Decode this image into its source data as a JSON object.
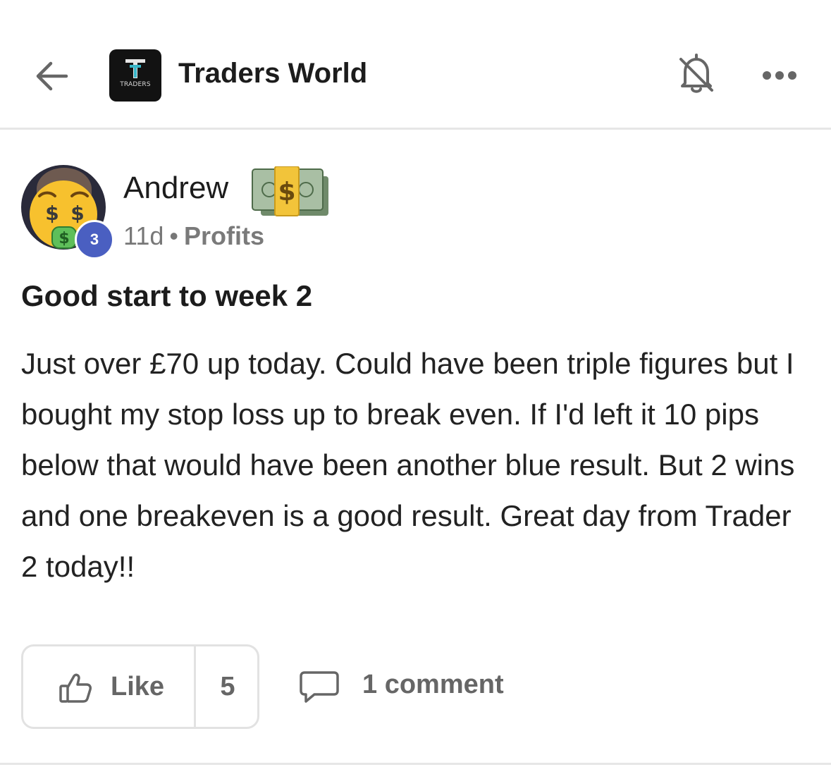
{
  "header": {
    "back_icon": "arrow-left-icon",
    "group_logo_text": "TRADERS",
    "group_title": "Traders World",
    "notifications_icon": "bell-off-icon",
    "more_icon": "more-horizontal-icon"
  },
  "post": {
    "author": {
      "name": "Andrew",
      "name_emoji": "money-with-wings-icon",
      "avatar_emoji": "money-mouth-face-icon",
      "level": "3"
    },
    "time_ago": "11d",
    "separator": "•",
    "category": "Profits",
    "title": "Good start to week 2",
    "body": "Just over £70 up today. Could have been triple figures but I bought my stop loss up to break even. If I'd left it 10 pips below that would have been another blue result. But 2 wins and one breakeven is a good result. Great day from Trader 2 today!!",
    "actions": {
      "like_label": "Like",
      "like_count": "5",
      "comment_label": "1 comment"
    }
  },
  "colors": {
    "level_badge": "#4a5fc1",
    "muted_text": "#777777",
    "divider": "#e6e6e6"
  }
}
